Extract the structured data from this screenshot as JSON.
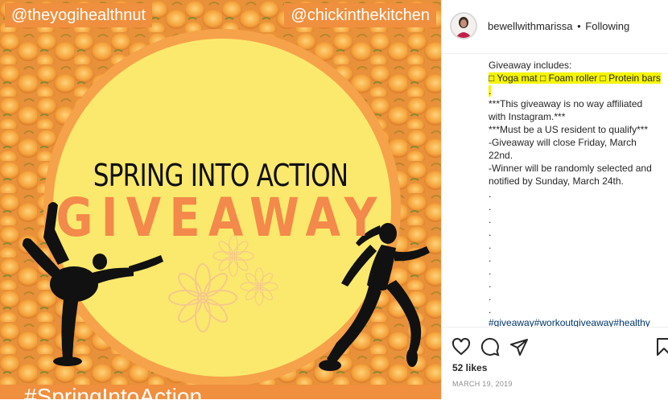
{
  "post": {
    "handle_left": "@theyogihealthnut",
    "handle_right": "@chickinthekitchen",
    "headline": "SPRING INTO ACTION",
    "subheadline": "GIVEAWAY",
    "bottom_banner": "#SpringIntoAction"
  },
  "header": {
    "username": "bewellwithmarissa",
    "separator": "•",
    "follow_status": "Following"
  },
  "caption": {
    "lines": [
      "Giveaway includes:",
      "□ Yoga mat □ Foam roller □ Protein bars .",
      "***This giveaway is no way affiliated with Instagram.***",
      "***Must be a US resident to qualify***",
      "-Giveaway will close Friday, March 22nd.",
      "-Winner will be randomly selected and notified by Sunday, March 24th.",
      ".",
      ".",
      ".",
      ".",
      ".",
      ".",
      ".",
      ".",
      ".",
      "."
    ],
    "hashtags": "#giveaway#workoutgiveaway#healthy"
  },
  "footer": {
    "likes": "52 likes",
    "date": "MARCH 19, 2019"
  },
  "icons": [
    "heart-icon",
    "comment-icon",
    "share-icon",
    "bookmark-icon"
  ],
  "colors": {
    "accent_orange": "#f08f3e",
    "giveaway_orange": "#f3894a",
    "circle_yellow": "#fbe96d",
    "highlight": "#f5f500",
    "hashtag_blue": "#00376b"
  }
}
